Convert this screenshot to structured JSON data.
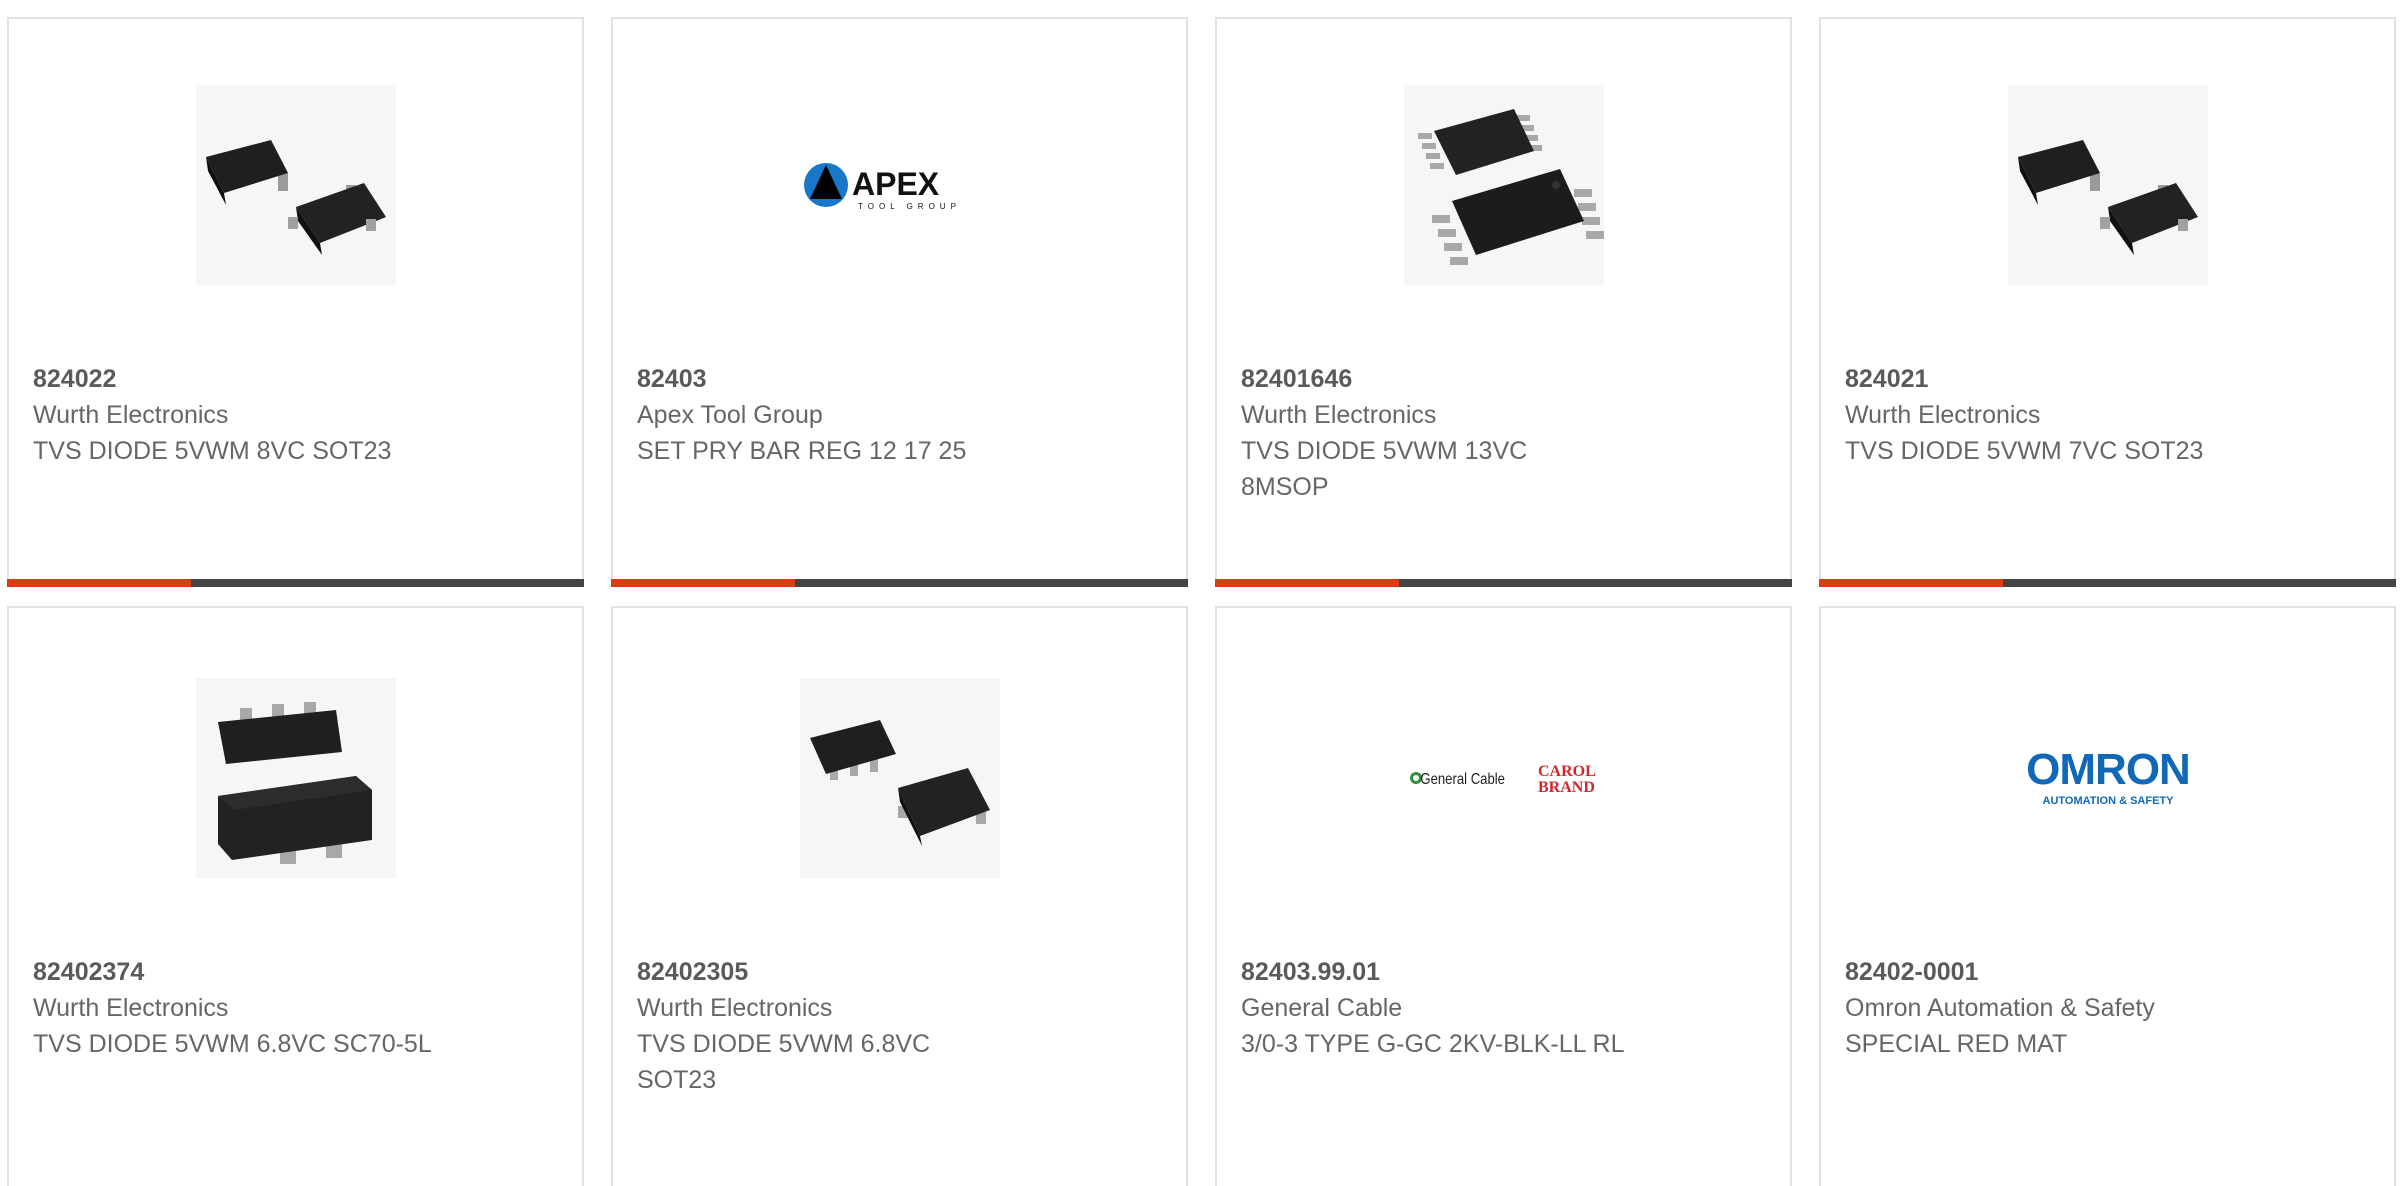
{
  "colors": {
    "accent": "#e03a12",
    "bar": "#444444",
    "border": "#e2e2e2",
    "text": "#666666"
  },
  "products": [
    {
      "part_number": "824022",
      "manufacturer": "Wurth Electronics",
      "description": "TVS DIODE 5VWM 8VC SOT23",
      "image": "sot23-package-icon"
    },
    {
      "part_number": "82403",
      "manufacturer": "Apex Tool Group",
      "description": "SET PRY BAR REG 12 17 25",
      "image": "apex-tool-group-logo",
      "logo_text": "APEX",
      "logo_subtext": "TOOL GROUP"
    },
    {
      "part_number": "82401646",
      "manufacturer": "Wurth Electronics",
      "description": "TVS DIODE 5VWM 13VC 8MSOP",
      "image": "msop8-package-icon"
    },
    {
      "part_number": "824021",
      "manufacturer": "Wurth Electronics",
      "description": "TVS DIODE 5VWM 7VC SOT23",
      "image": "sot23-package-icon"
    },
    {
      "part_number": "82402374",
      "manufacturer": "Wurth Electronics",
      "description": "TVS DIODE 5VWM 6.8VC SC70-5L",
      "image": "sc70-package-icon"
    },
    {
      "part_number": "82402305",
      "manufacturer": "Wurth Electronics",
      "description": "TVS DIODE 5VWM 6.8VC SOT23",
      "image": "sot23-6-package-icon"
    },
    {
      "part_number": "82403.99.01",
      "manufacturer": "General Cable",
      "description": "3/0-3 TYPE G-GC 2KV-BLK-LL RL",
      "image": "general-cable-logo",
      "logo_text": "General Cable",
      "logo_text2": "CAROL",
      "logo_text3": "BRAND"
    },
    {
      "part_number": "82402-0001",
      "manufacturer": "Omron Automation & Safety",
      "description": "SPECIAL RED MAT",
      "image": "omron-logo",
      "logo_text": "OMRON",
      "logo_subtext": "AUTOMATION & SAFETY"
    }
  ]
}
